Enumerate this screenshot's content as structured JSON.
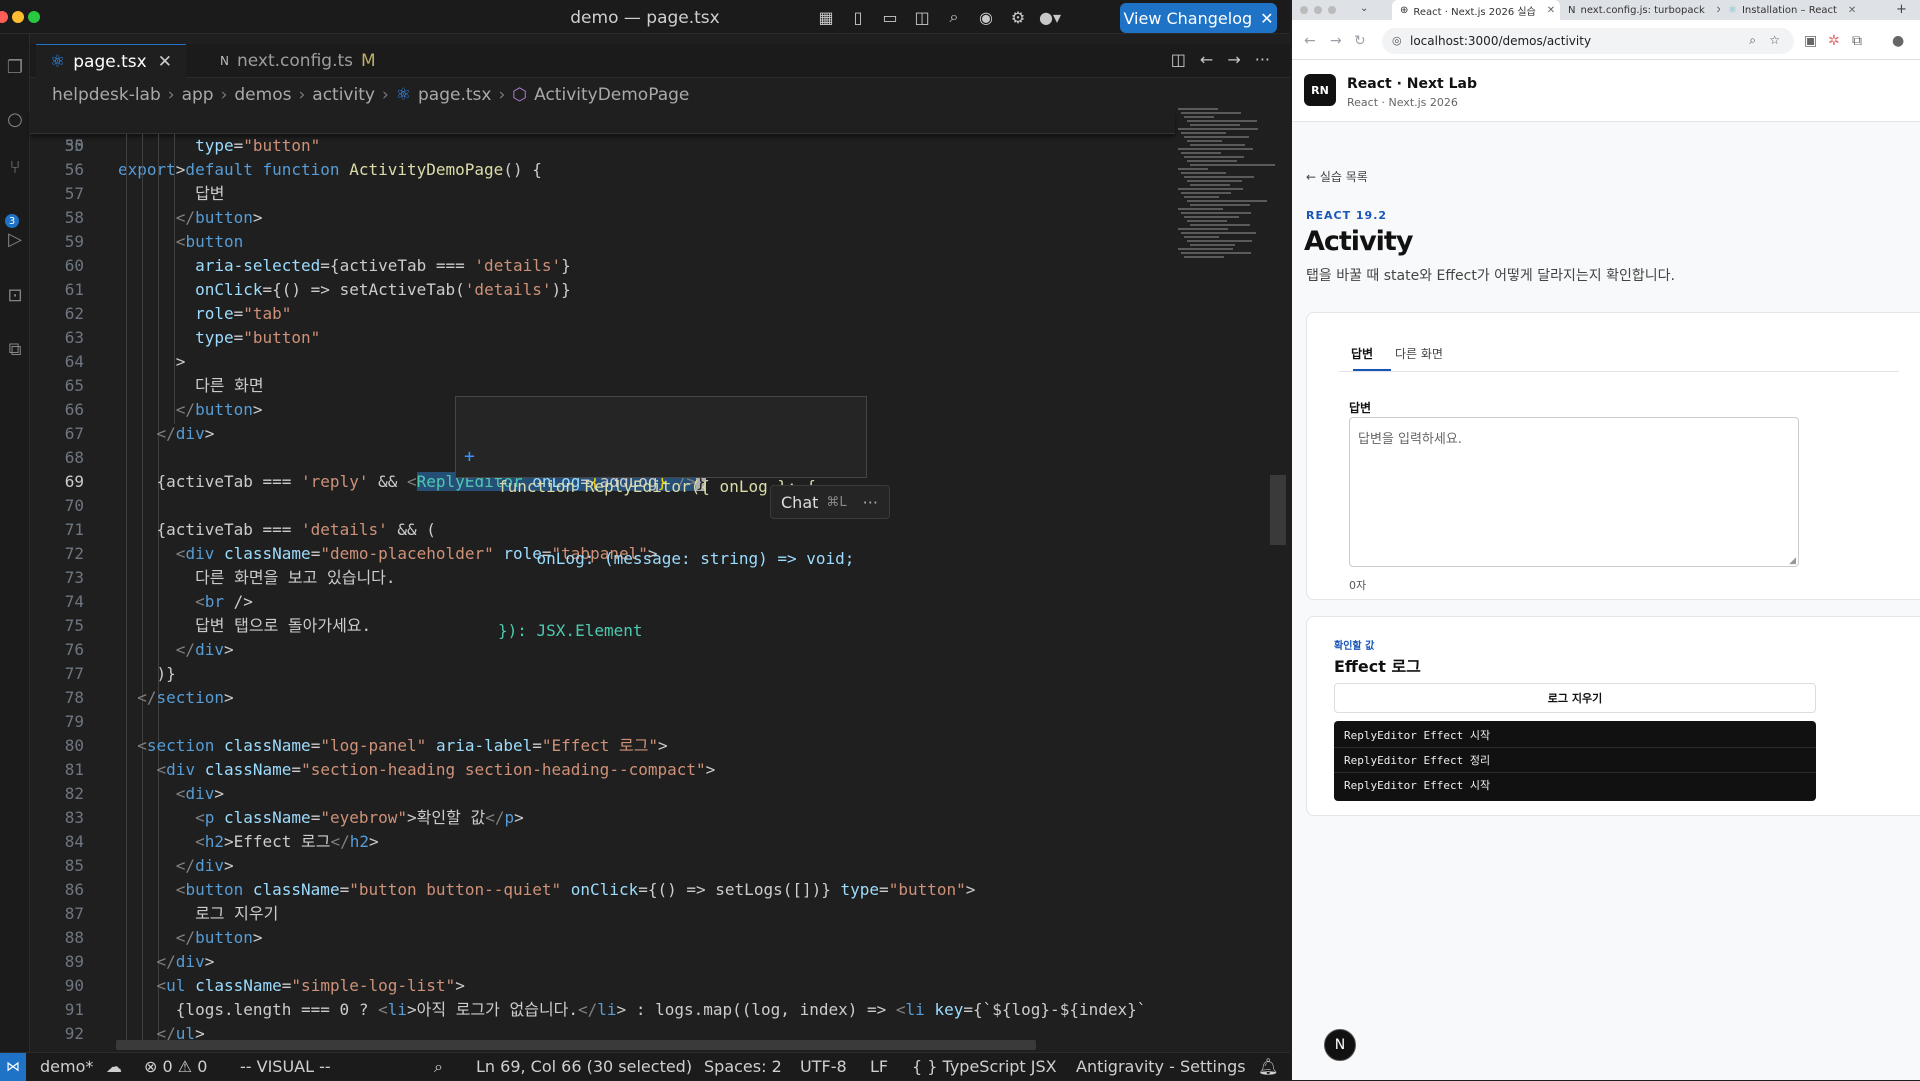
{
  "window": {
    "title": "demo — page.tsx",
    "changelog_label": "View Changelog"
  },
  "tabs": [
    {
      "label": "page.tsx",
      "icon": "react-icon"
    },
    {
      "label": "next.config.ts",
      "icon": "next-icon",
      "badge": "M"
    }
  ],
  "breadcrumbs": [
    "helpdesk-lab",
    "app",
    "demos",
    "activity",
    "page.tsx",
    "ActivityDemoPage"
  ],
  "activity_badge": "3",
  "sticky": {
    "line": "30",
    "code": "export default function ActivityDemoPage() {"
  },
  "lines": [
    {
      "n": "55",
      "code": "        type=\"button\""
    },
    {
      "n": "56",
      "code": "      >"
    },
    {
      "n": "57",
      "code": "        답변"
    },
    {
      "n": "58",
      "code": "      </button>"
    },
    {
      "n": "59",
      "code": "      <button"
    },
    {
      "n": "60",
      "code": "        aria-selected={activeTab === 'details'}"
    },
    {
      "n": "61",
      "code": "        onClick={() => setActiveTab('details')}"
    },
    {
      "n": "62",
      "code": "        role=\"tab\""
    },
    {
      "n": "63",
      "code": "        type=\"button\""
    },
    {
      "n": "64",
      "code": "      >"
    },
    {
      "n": "65",
      "code": "        다른 화면"
    },
    {
      "n": "66",
      "code": "      </button>"
    },
    {
      "n": "67",
      "code": "    </div>"
    },
    {
      "n": "68",
      "code": ""
    },
    {
      "n": "69",
      "code": "    {activeTab === 'reply' && <ReplyEditor onLog={addLog} />}"
    },
    {
      "n": "70",
      "code": ""
    },
    {
      "n": "71",
      "code": "    {activeTab === 'details' && ("
    },
    {
      "n": "72",
      "code": "      <div className=\"demo-placeholder\" role=\"tabpanel\">"
    },
    {
      "n": "73",
      "code": "        다른 화면을 보고 있습니다."
    },
    {
      "n": "74",
      "code": "        <br />"
    },
    {
      "n": "75",
      "code": "        답변 탭으로 돌아가세요."
    },
    {
      "n": "76",
      "code": "      </div>"
    },
    {
      "n": "77",
      "code": "    )}"
    },
    {
      "n": "78",
      "code": "  </section>"
    },
    {
      "n": "79",
      "code": ""
    },
    {
      "n": "80",
      "code": "  <section className=\"log-panel\" aria-label=\"Effect 로그\">"
    },
    {
      "n": "81",
      "code": "    <div className=\"section-heading section-heading--compact\">"
    },
    {
      "n": "82",
      "code": "      <div>"
    },
    {
      "n": "83",
      "code": "        <p className=\"eyebrow\">확인할 값</p>"
    },
    {
      "n": "84",
      "code": "        <h2>Effect 로그</h2>"
    },
    {
      "n": "85",
      "code": "      </div>"
    },
    {
      "n": "86",
      "code": "      <button className=\"button button--quiet\" onClick={() => setLogs([])} type=\"button\">"
    },
    {
      "n": "87",
      "code": "        로그 지우기"
    },
    {
      "n": "88",
      "code": "      </button>"
    },
    {
      "n": "89",
      "code": "    </div>"
    },
    {
      "n": "90",
      "code": "    <ul className=\"simple-log-list\">"
    },
    {
      "n": "91",
      "code": "      {logs.length === 0 ? <li>아직 로그가 없습니다.</li> : logs.map((log, index) => <li key={`${log}-${index}`"
    },
    {
      "n": "92",
      "code": "    </ul>"
    }
  ],
  "hover": {
    "line1": "function ReplyEditor({ onLog }: {",
    "line2": "    onLog: (message: string) => void;",
    "line3": "}): JSX.Element"
  },
  "chat": {
    "label": "Chat",
    "shortcut": "⌘L",
    "more": "···"
  },
  "status": {
    "branch": "demo*",
    "problems": "⊗ 0 ⚠ 0",
    "mode": "-- VISUAL --",
    "position": "Ln 69, Col 66 (30 selected)",
    "spaces": "Spaces: 2",
    "encoding": "UTF-8",
    "eol": "LF",
    "language": "{ } TypeScript JSX",
    "settings": "Antigravity - Settings"
  },
  "browser": {
    "tabs": [
      "React · Next.js 2026 실습",
      "next.config.js: turbopack",
      "Installation – React"
    ],
    "url": "localhost:3000/demos/activity"
  },
  "app": {
    "logo": "RN",
    "brand": "React · Next Lab",
    "brand_sub": "React · Next.js 2026",
    "back": "← 실습 목록",
    "eyebrow": "REACT 19.2",
    "title": "Activity",
    "description": "탭을 바꿀 때 state와 Effect가 어떻게 달라지는지 확인합니다.",
    "tabs": [
      "답변",
      "다른 화면"
    ],
    "field_label": "답변",
    "placeholder": "답변을 입력하세요.",
    "count": "0자",
    "log_eyebrow": "확인할 값",
    "log_title": "Effect 로그",
    "clear_label": "로그 지우기",
    "logs": [
      "ReplyEditor Effect 시작",
      "ReplyEditor Effect 정리",
      "ReplyEditor Effect 시작"
    ],
    "float_label": "N"
  },
  "colors": {
    "accent": "#1f73c7",
    "keyword": "#569cd6",
    "string": "#ce9178",
    "selection": "#264f78"
  }
}
